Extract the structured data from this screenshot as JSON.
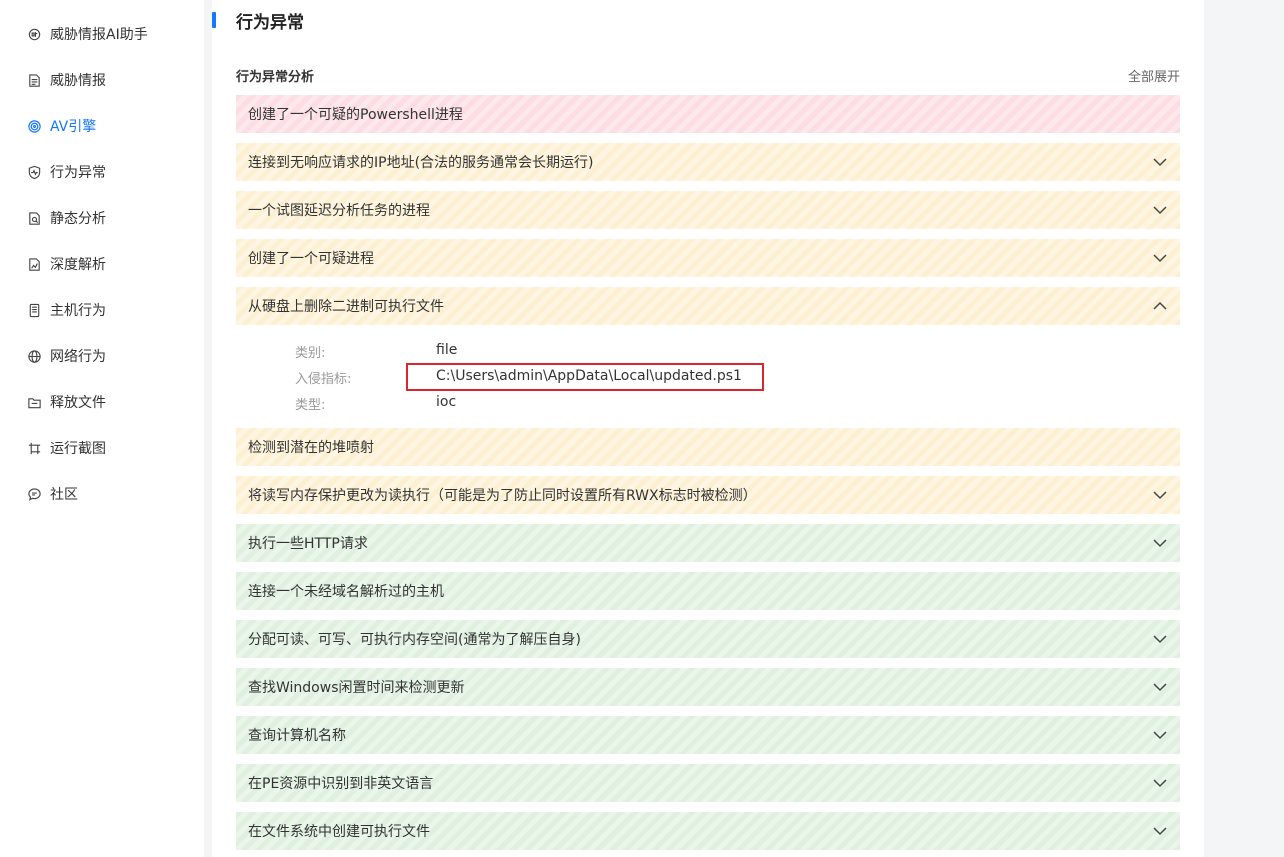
{
  "sidebar": {
    "items": [
      {
        "label": "威胁情报AI助手",
        "icon": "ai-brain-icon",
        "active": false
      },
      {
        "label": "威胁情报",
        "icon": "document-icon",
        "active": false
      },
      {
        "label": "AV引擎",
        "icon": "target-icon",
        "active": true
      },
      {
        "label": "行为异常",
        "icon": "shield-pulse-icon",
        "active": false
      },
      {
        "label": "静态分析",
        "icon": "file-analysis-icon",
        "active": false
      },
      {
        "label": "深度解析",
        "icon": "chart-file-icon",
        "active": false
      },
      {
        "label": "主机行为",
        "icon": "host-icon",
        "active": false
      },
      {
        "label": "网络行为",
        "icon": "globe-icon",
        "active": false
      },
      {
        "label": "释放文件",
        "icon": "folder-icon",
        "active": false
      },
      {
        "label": "运行截图",
        "icon": "screenshot-icon",
        "active": false
      },
      {
        "label": "社区",
        "icon": "chat-icon",
        "active": false
      }
    ]
  },
  "main": {
    "title": "行为异常",
    "section_title": "行为异常分析",
    "expand_all": "全部展开",
    "rows": [
      {
        "label": "创建了一个可疑的Powershell进程",
        "severity": "red",
        "chevron": "none"
      },
      {
        "label": "连接到无响应请求的IP地址(合法的服务通常会长期运行)",
        "severity": "yellow",
        "chevron": "down"
      },
      {
        "label": "一个试图延迟分析任务的进程",
        "severity": "yellow",
        "chevron": "down"
      },
      {
        "label": "创建了一个可疑进程",
        "severity": "yellow",
        "chevron": "down"
      },
      {
        "label": "从硬盘上删除二进制可执行文件",
        "severity": "yellow",
        "chevron": "up"
      },
      {
        "label": "检测到潜在的堆喷射",
        "severity": "yellow",
        "chevron": "none"
      },
      {
        "label": "将读写内存保护更改为读执行（可能是为了防止同时设置所有RWX标志时被检测）",
        "severity": "yellow",
        "chevron": "down"
      },
      {
        "label": "执行一些HTTP请求",
        "severity": "green",
        "chevron": "down"
      },
      {
        "label": "连接一个未经域名解析过的主机",
        "severity": "green",
        "chevron": "none"
      },
      {
        "label": "分配可读、可写、可执行内存空间(通常为了解压自身)",
        "severity": "green",
        "chevron": "down"
      },
      {
        "label": "查找Windows闲置时间来检测更新",
        "severity": "green",
        "chevron": "down"
      },
      {
        "label": "查询计算机名称",
        "severity": "green",
        "chevron": "down"
      },
      {
        "label": "在PE资源中识别到非英文语言",
        "severity": "green",
        "chevron": "down"
      },
      {
        "label": "在文件系统中创建可执行文件",
        "severity": "green",
        "chevron": "down"
      }
    ],
    "expanded_detail": {
      "category_label": "类别:",
      "category_value": "file",
      "indicator_label": "入侵指标:",
      "indicator_value": "C:\\Users\\admin\\AppData\\Local\\updated.ps1",
      "type_label": "类型:",
      "type_value": "ioc"
    }
  },
  "colors": {
    "accent": "#1677ff",
    "red_row": "#fbdde3",
    "yellow_row": "#fdf0d2",
    "green_row": "#dff0df",
    "highlight_border": "#d9262e"
  }
}
